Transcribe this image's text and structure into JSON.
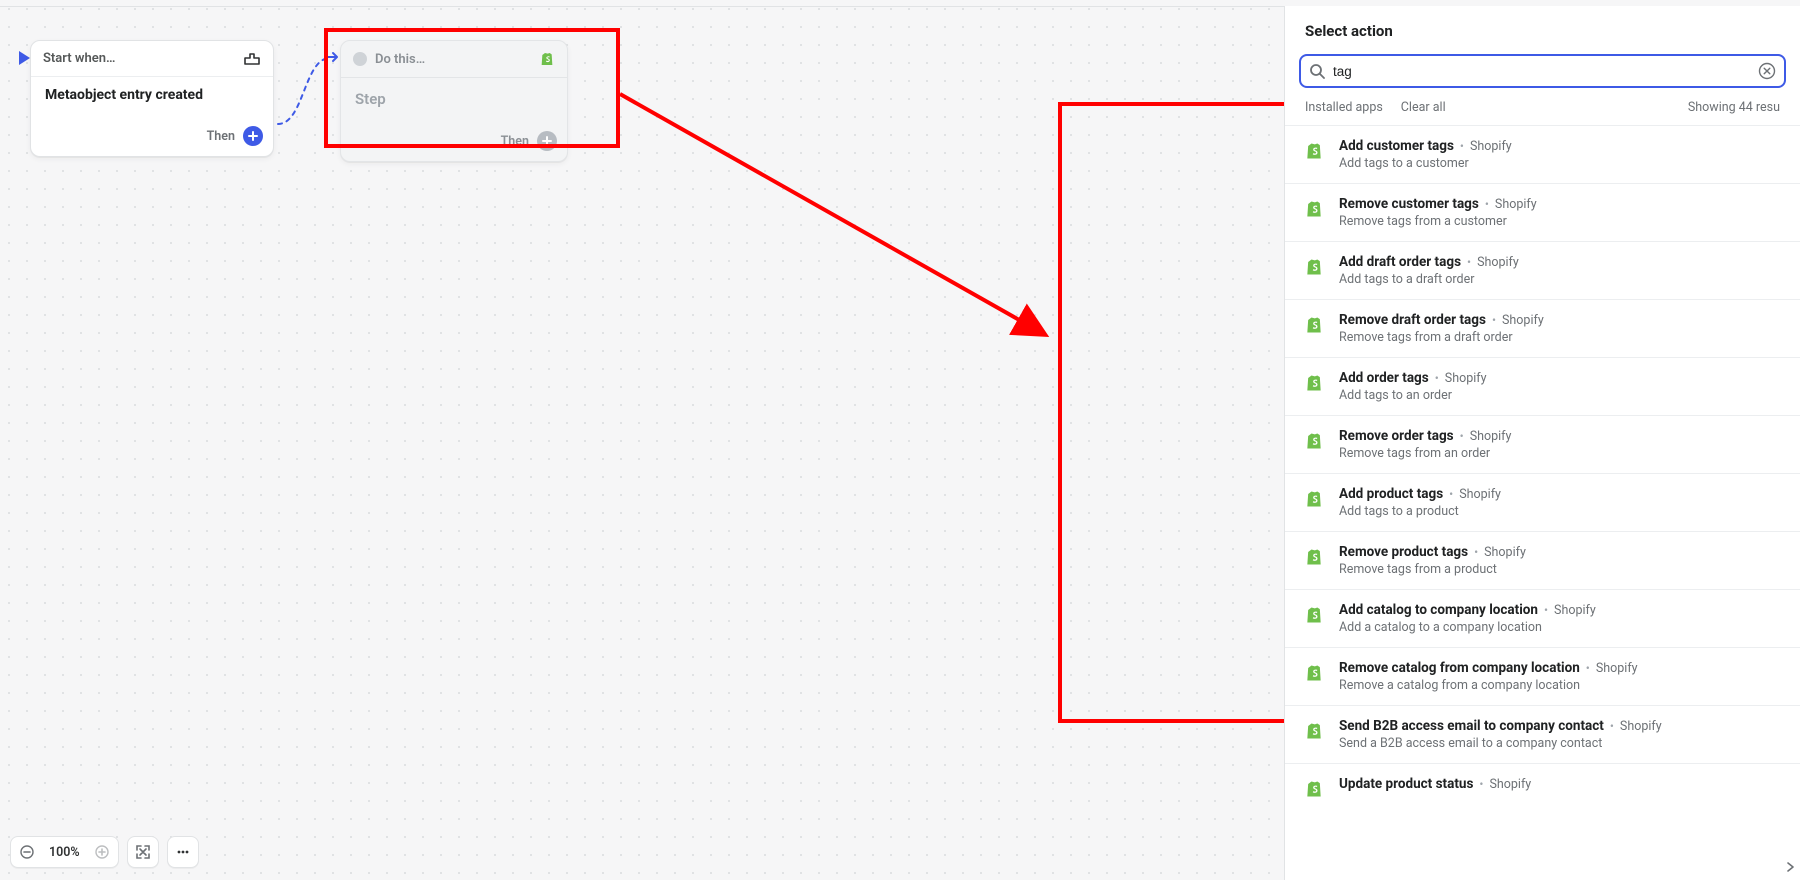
{
  "canvas": {
    "start_card": {
      "header": "Start when…",
      "title": "Metaobject entry created",
      "then": "Then"
    },
    "do_card": {
      "header": "Do this…",
      "sub": "Step",
      "then": "Then"
    }
  },
  "panel": {
    "title": "Select action",
    "search_value": "tag",
    "search_placeholder": "",
    "filters": {
      "installed": "Installed apps",
      "clear": "Clear all",
      "count": "Showing 44 resu"
    },
    "actions": [
      {
        "name": "Add customer tags",
        "app": "Shopify",
        "desc": "Add tags to a customer"
      },
      {
        "name": "Remove customer tags",
        "app": "Shopify",
        "desc": "Remove tags from a customer"
      },
      {
        "name": "Add draft order tags",
        "app": "Shopify",
        "desc": "Add tags to a draft order"
      },
      {
        "name": "Remove draft order tags",
        "app": "Shopify",
        "desc": "Remove tags from a draft order"
      },
      {
        "name": "Add order tags",
        "app": "Shopify",
        "desc": "Add tags to an order"
      },
      {
        "name": "Remove order tags",
        "app": "Shopify",
        "desc": "Remove tags from an order"
      },
      {
        "name": "Add product tags",
        "app": "Shopify",
        "desc": "Add tags to a product"
      },
      {
        "name": "Remove product tags",
        "app": "Shopify",
        "desc": "Remove tags from a product"
      },
      {
        "name": "Add catalog to company location",
        "app": "Shopify",
        "desc": "Add a catalog to a company location"
      },
      {
        "name": "Remove catalog from company location",
        "app": "Shopify",
        "desc": "Remove a catalog from a company location"
      },
      {
        "name": "Send B2B access email to company contact",
        "app": "Shopify",
        "desc": "Send a B2B access email to a company contact"
      },
      {
        "name": "Update product status",
        "app": "Shopify",
        "desc": ""
      }
    ]
  },
  "toolbar": {
    "zoom": "100%"
  },
  "icons": {
    "shopify_color": "#6fbf4b"
  }
}
